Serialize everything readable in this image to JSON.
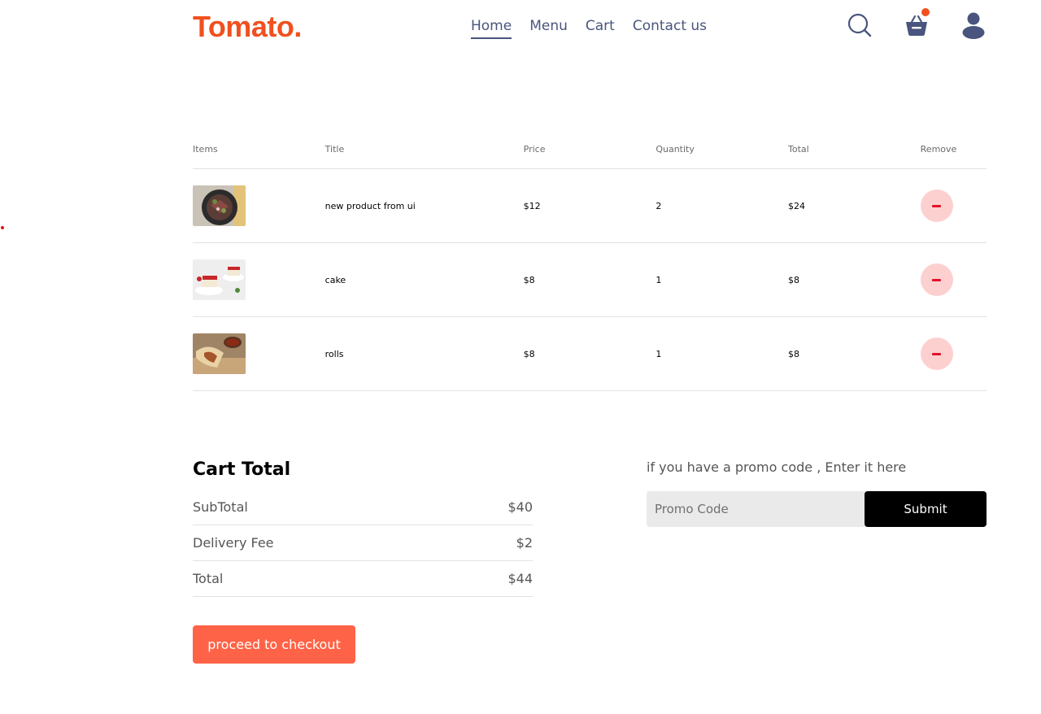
{
  "navbar": {
    "logo": "Tomato.",
    "menu": [
      {
        "label": "Home",
        "active": true
      },
      {
        "label": "Menu",
        "active": false
      },
      {
        "label": "Cart",
        "active": false
      },
      {
        "label": "Contact us",
        "active": false
      }
    ],
    "icons": [
      "search-icon",
      "basket-icon",
      "profile-icon"
    ],
    "accent_color": "#f0501f"
  },
  "cart": {
    "headers": [
      "Items",
      "Title",
      "Price",
      "Quantity",
      "Total",
      "Remove"
    ],
    "items": [
      {
        "image": "salad-thumbnail",
        "title": "new product from ui",
        "price": "$12",
        "quantity": "2",
        "total": "$24"
      },
      {
        "image": "cake-thumbnail",
        "title": "cake",
        "price": "$8",
        "quantity": "1",
        "total": "$8"
      },
      {
        "image": "rolls-thumbnail",
        "title": "rolls",
        "price": "$8",
        "quantity": "1",
        "total": "$8"
      }
    ]
  },
  "totals": {
    "heading": "Cart Total",
    "rows": [
      {
        "label": "SubTotal",
        "value": "$40"
      },
      {
        "label": "Delivery Fee",
        "value": "$2"
      },
      {
        "label": "Total",
        "value": "$44"
      }
    ],
    "checkout_label": "proceed to checkout",
    "checkout_color": "#ff6347"
  },
  "promo": {
    "prompt": "if you have a promo code , Enter it here",
    "placeholder": "Promo Code",
    "value": "",
    "submit_label": "Submit"
  }
}
